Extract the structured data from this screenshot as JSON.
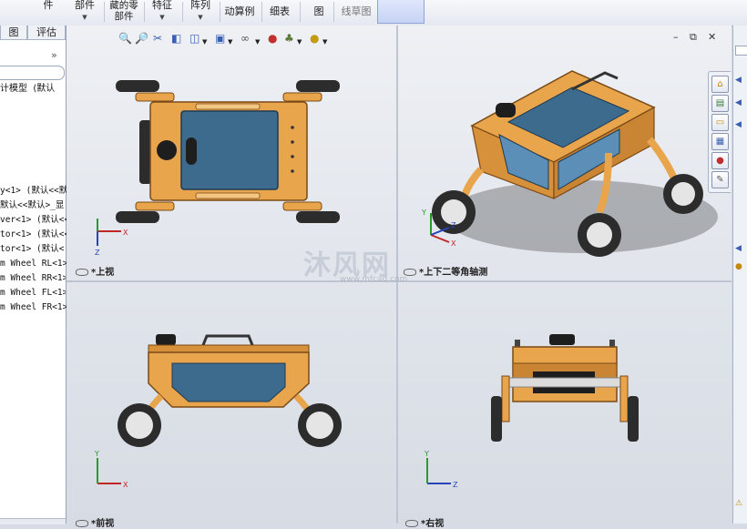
{
  "toolbar": {
    "items": [
      {
        "label": "件"
      },
      {
        "label": "部件"
      },
      {
        "label": "藏的零部件"
      },
      {
        "label": "特征"
      },
      {
        "label": "阵列"
      },
      {
        "label": "动算例"
      },
      {
        "label": "细表"
      },
      {
        "label": "图"
      },
      {
        "label": "线草图"
      }
    ]
  },
  "left_panel": {
    "tabs": [
      "图",
      "评估"
    ],
    "expand_label": "»",
    "model_label": "计模型",
    "model_config": "(默认",
    "tree_items": [
      "y<1> (默认<<默",
      "默认<<默认>_显",
      "ver<1> (默认<<",
      "tor<1> (默认<<",
      "tor<1> (默认<",
      "m Wheel RL<1>",
      "m Wheel RR<1>",
      "m Wheel FL<1>",
      "m Wheel FR<1>"
    ]
  },
  "viewport": {
    "views": [
      {
        "label": "*上视"
      },
      {
        "label": "*上下二等角轴测"
      },
      {
        "label": "*前视"
      },
      {
        "label": "*右视"
      }
    ],
    "axes": {
      "x": "X",
      "y": "Y",
      "z": "Z"
    },
    "watermark": "沐风网",
    "watermark_url": "www.mfcad.com"
  },
  "colors": {
    "body_orange": "#e9a54c",
    "body_edge": "#7a4a16",
    "panel_blue": "#3d6b8e",
    "tire_black": "#2c2c2c",
    "viewport_bg": "#e3e6ec"
  }
}
